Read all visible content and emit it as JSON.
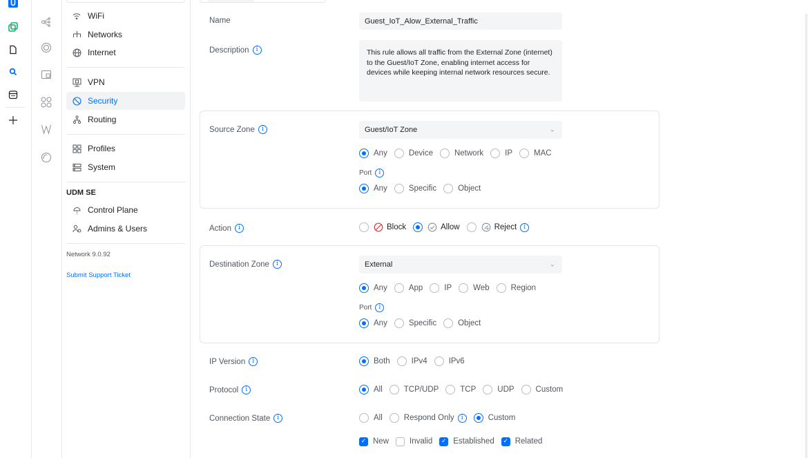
{
  "colors": {
    "accent": "#006fff",
    "brand_green": "#13b26b",
    "text": "#212327",
    "muted": "#50565e"
  },
  "icon_rail": [
    "unifi-logo-icon",
    "apps-icon",
    "document-icon",
    "search-icon",
    "calendar-icon",
    "plus-icon"
  ],
  "sub_rail": [
    "topology-icon",
    "target-icon",
    "devices-icon",
    "clients-icon",
    "insights-icon",
    "radio-icon"
  ],
  "nav": {
    "items": [
      {
        "label": "WiFi",
        "icon": "wifi-icon"
      },
      {
        "label": "Networks",
        "icon": "network-icon"
      },
      {
        "label": "Internet",
        "icon": "globe-icon"
      },
      {
        "label": "VPN",
        "icon": "vpn-icon"
      },
      {
        "label": "Security",
        "icon": "shield-icon",
        "active": true
      },
      {
        "label": "Routing",
        "icon": "routing-icon"
      },
      {
        "label": "Profiles",
        "icon": "profiles-icon"
      },
      {
        "label": "System",
        "icon": "system-icon"
      },
      {
        "label": "Control Plane",
        "icon": "control-plane-icon"
      },
      {
        "label": "Admins & Users",
        "icon": "users-icon"
      }
    ],
    "device_heading": "UDM SE",
    "version": "Network 9.0.92",
    "support_link": "Submit Support Ticket"
  },
  "form": {
    "name_label": "Name",
    "name_value": "Guest_IoT_Alow_External_Traffic",
    "description_label": "Description",
    "description_value": "This rule allows all traffic from the External Zone (internet) to the Guest/IoT Zone, enabling internet access for devices while keeping internal network resources secure.",
    "source": {
      "label": "Source Zone",
      "zone": "Guest/IoT Zone",
      "options": [
        "Any",
        "Device",
        "Network",
        "IP",
        "MAC"
      ],
      "selected": "Any",
      "port_label": "Port",
      "port_options": [
        "Any",
        "Specific",
        "Object"
      ],
      "port_selected": "Any"
    },
    "action": {
      "label": "Action",
      "options": [
        "Block",
        "Allow",
        "Reject"
      ],
      "selected": "Allow"
    },
    "destination": {
      "label": "Destination Zone",
      "zone": "External",
      "options": [
        "Any",
        "App",
        "IP",
        "Web",
        "Region"
      ],
      "selected": "Any",
      "port_label": "Port",
      "port_options": [
        "Any",
        "Specific",
        "Object"
      ],
      "port_selected": "Any"
    },
    "ip_version": {
      "label": "IP Version",
      "options": [
        "Both",
        "IPv4",
        "IPv6"
      ],
      "selected": "Both"
    },
    "protocol": {
      "label": "Protocol",
      "options": [
        "All",
        "TCP/UDP",
        "TCP",
        "UDP",
        "Custom"
      ],
      "selected": "All"
    },
    "connection_state": {
      "label": "Connection State",
      "options": [
        "All",
        "Respond Only",
        "Custom"
      ],
      "selected": "Custom",
      "checkboxes": [
        {
          "label": "New",
          "checked": true
        },
        {
          "label": "Invalid",
          "checked": false
        },
        {
          "label": "Established",
          "checked": true
        },
        {
          "label": "Related",
          "checked": true
        }
      ]
    }
  }
}
